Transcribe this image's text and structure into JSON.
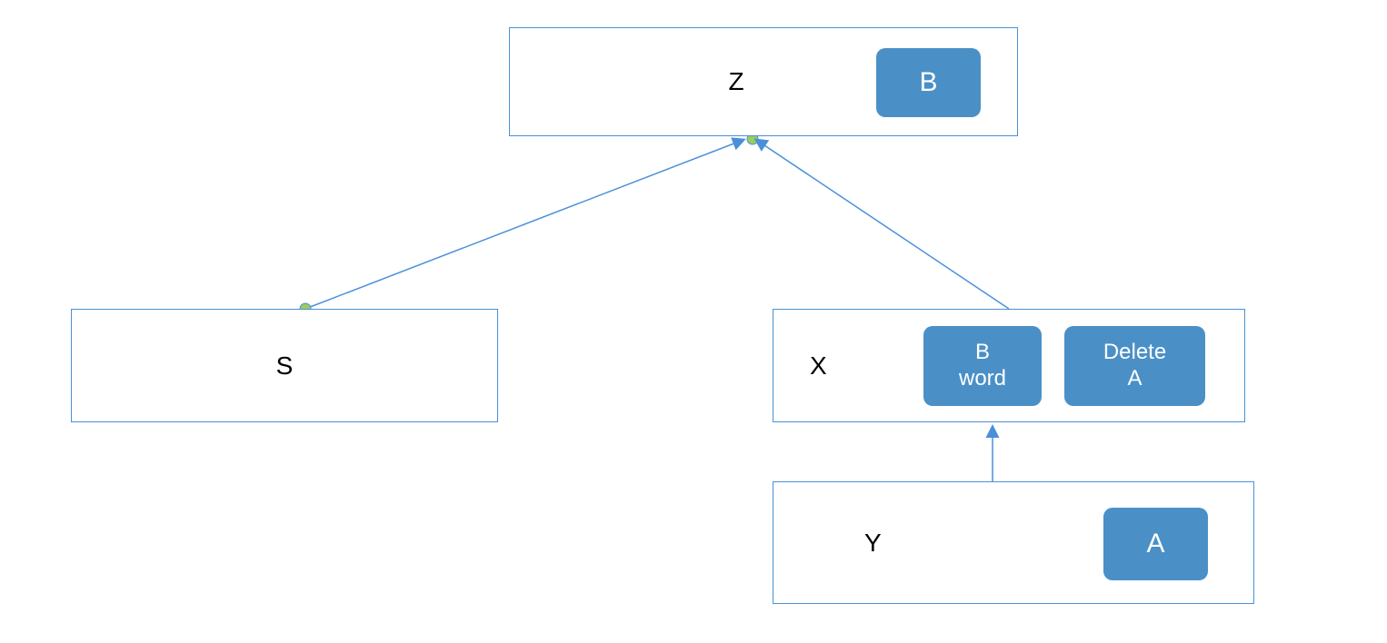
{
  "nodes": {
    "z": {
      "label": "Z",
      "badges": [
        {
          "text": "B"
        }
      ]
    },
    "s": {
      "label": "S",
      "badges": []
    },
    "x": {
      "label": "X",
      "badges": [
        {
          "text": "B\nword"
        },
        {
          "text": "Delete\nA"
        }
      ]
    },
    "y": {
      "label": "Y",
      "badges": [
        {
          "text": "A"
        }
      ]
    }
  },
  "colors": {
    "node_border": "#4a90d9",
    "badge_fill": "#4a90c7",
    "badge_text": "#ffffff",
    "arrow_stroke": "#4a90d9",
    "endpoint_dot_fill": "#9acd5c",
    "endpoint_dot_stroke": "#4a90d9"
  },
  "edges": [
    {
      "from": "s",
      "to": "z",
      "style": "dot-to-arrow"
    },
    {
      "from": "x",
      "to": "z",
      "style": "line-to-arrow"
    },
    {
      "from": "y",
      "to": "x",
      "style": "arrow"
    }
  ]
}
